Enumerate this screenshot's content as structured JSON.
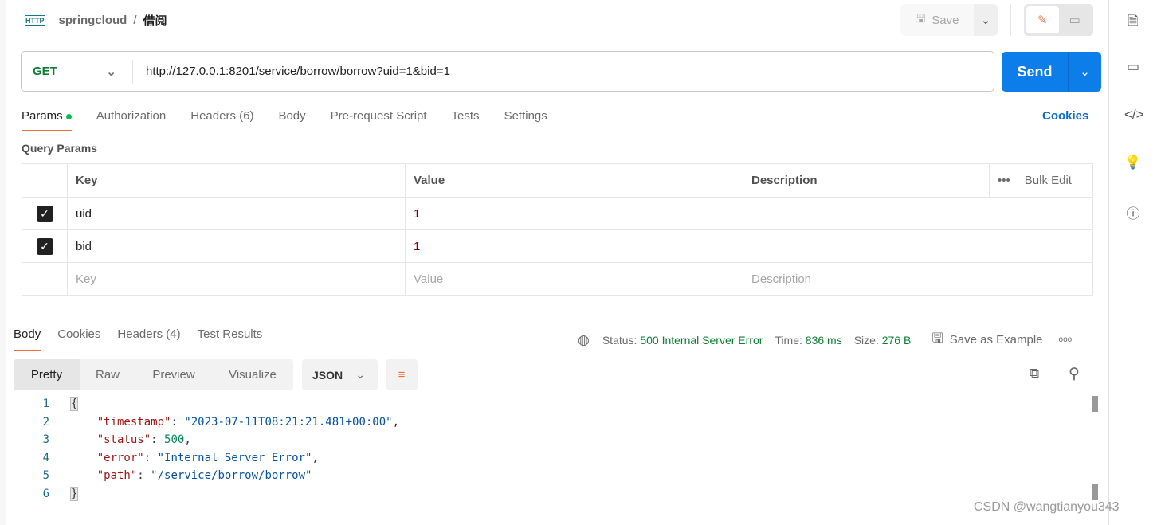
{
  "header": {
    "collection": "springcloud",
    "separator": "/",
    "request_name": "借阅",
    "save_label": "Save"
  },
  "request": {
    "method": "GET",
    "url": "http://127.0.0.1:8201/service/borrow/borrow?uid=1&bid=1",
    "send_label": "Send"
  },
  "tabs": [
    {
      "label": "Params"
    },
    {
      "label": "Authorization"
    },
    {
      "label": "Headers (6)"
    },
    {
      "label": "Body"
    },
    {
      "label": "Pre-request Script"
    },
    {
      "label": "Tests"
    },
    {
      "label": "Settings"
    }
  ],
  "cookies_label": "Cookies",
  "query_params": {
    "title": "Query Params",
    "headers": [
      "Key",
      "Value",
      "Description"
    ],
    "bulk_edit": "Bulk Edit",
    "rows": [
      {
        "key": "uid",
        "value": "1",
        "checked": true
      },
      {
        "key": "bid",
        "value": "1",
        "checked": true
      }
    ],
    "placeholders": {
      "key": "Key",
      "value": "Value",
      "description": "Description"
    }
  },
  "response": {
    "tabs": [
      "Body",
      "Cookies",
      "Headers (4)",
      "Test Results"
    ],
    "status_label": "Status:",
    "status": "500 Internal Server Error",
    "time_label": "Time:",
    "time": "836 ms",
    "size_label": "Size:",
    "size": "276 B",
    "save_example": "Save as Example",
    "views": [
      "Pretty",
      "Raw",
      "Preview",
      "Visualize"
    ],
    "format": "JSON",
    "lines": [
      "1",
      "2",
      "3",
      "4",
      "5",
      "6"
    ],
    "body": {
      "open": "{",
      "k1": "\"timestamp\"",
      "v1": "\"2023-07-11T08:21:21.481+00:00\"",
      "k2": "\"status\"",
      "v2": "500",
      "k3": "\"error\"",
      "v3": "\"Internal Server Error\"",
      "k4": "\"path\"",
      "v4": "/service/borrow/borrow",
      "close": "}"
    }
  },
  "watermark": "CSDN @wangtianyou343",
  "colors": {
    "accent": "#f26b3a",
    "send": "#0c7de9",
    "method": "#0c7e32",
    "status": "#0c7e32"
  }
}
